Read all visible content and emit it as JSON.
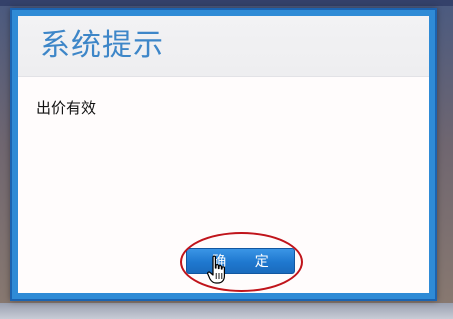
{
  "dialog": {
    "title": "系统提示",
    "message": "出价有效",
    "confirm_label": "确 定"
  },
  "colors": {
    "frame": "#2f8bd6",
    "title_text": "#3d86c8",
    "button": "#1f78cf",
    "highlight": "#c0141b"
  },
  "icons": {
    "cursor": "hand-pointer-icon"
  }
}
